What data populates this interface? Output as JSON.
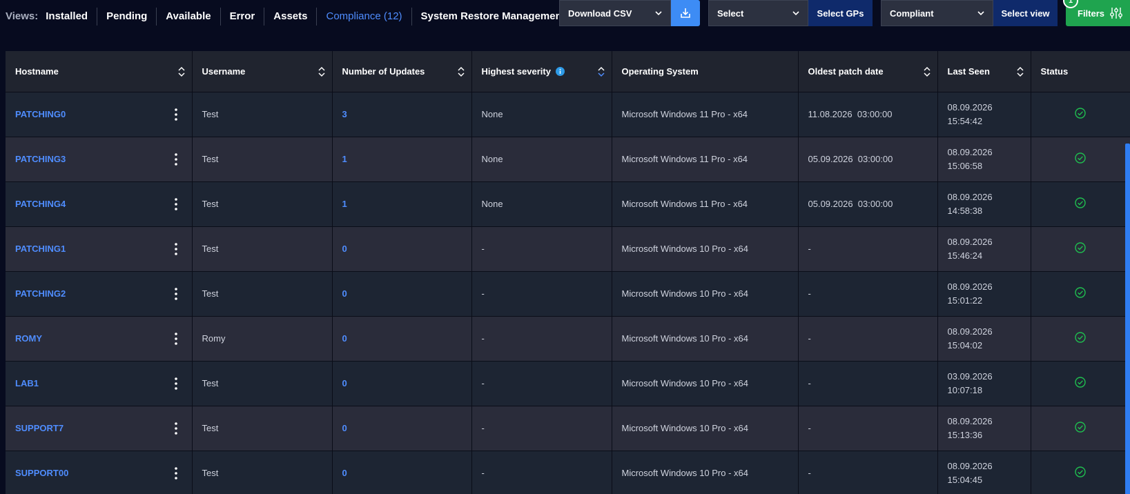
{
  "views": {
    "label": "Views:",
    "items": [
      "Installed",
      "Pending",
      "Available",
      "Error",
      "Assets",
      "Compliance (12)",
      "System Restore Management"
    ],
    "active_index": 5
  },
  "toolbar": {
    "download_csv_label": "Download CSV",
    "gp_select_label": "Select",
    "select_gps_label": "Select GPs",
    "view_select_label": "Compliant",
    "select_view_label": "Select view",
    "filters_label": "Filters",
    "filters_badge": "1"
  },
  "table": {
    "headers": {
      "hostname": "Hostname",
      "username": "Username",
      "updates": "Number of Updates",
      "severity": "Highest severity",
      "os": "Operating System",
      "oldest": "Oldest patch date",
      "last_seen": "Last Seen",
      "status": "Status"
    },
    "rows": [
      {
        "hostname": "PATCHING0",
        "username": "Test",
        "updates": "3",
        "severity": "None",
        "os": "Microsoft Windows 11 Pro - x64",
        "oldest": "11.08.2026  03:00:00",
        "last_seen_date": "08.09.2026",
        "last_seen_time": "15:54:42"
      },
      {
        "hostname": "PATCHING3",
        "username": "Test",
        "updates": "1",
        "severity": "None",
        "os": "Microsoft Windows 11 Pro - x64",
        "oldest": "05.09.2026  03:00:00",
        "last_seen_date": "08.09.2026",
        "last_seen_time": "15:06:58"
      },
      {
        "hostname": "PATCHING4",
        "username": "Test",
        "updates": "1",
        "severity": "None",
        "os": "Microsoft Windows 11 Pro - x64",
        "oldest": "05.09.2026  03:00:00",
        "last_seen_date": "08.09.2026",
        "last_seen_time": "14:58:38"
      },
      {
        "hostname": "PATCHING1",
        "username": "Test",
        "updates": "0",
        "severity": "-",
        "os": "Microsoft Windows 10 Pro - x64",
        "oldest": "-",
        "last_seen_date": "08.09.2026",
        "last_seen_time": "15:46:24"
      },
      {
        "hostname": "PATCHING2",
        "username": "Test",
        "updates": "0",
        "severity": "-",
        "os": "Microsoft Windows 10 Pro - x64",
        "oldest": "-",
        "last_seen_date": "08.09.2026",
        "last_seen_time": "15:01:22"
      },
      {
        "hostname": "ROMY",
        "username": "Romy",
        "updates": "0",
        "severity": "-",
        "os": "Microsoft Windows 10 Pro - x64",
        "oldest": "-",
        "last_seen_date": "08.09.2026",
        "last_seen_time": "15:04:02"
      },
      {
        "hostname": "LAB1",
        "username": "Test",
        "updates": "0",
        "severity": "-",
        "os": "Microsoft Windows 10 Pro - x64",
        "oldest": "-",
        "last_seen_date": "03.09.2026",
        "last_seen_time": "10:07:18"
      },
      {
        "hostname": "SUPPORT7",
        "username": "Test",
        "updates": "0",
        "severity": "-",
        "os": "Microsoft Windows 10 Pro - x64",
        "oldest": "-",
        "last_seen_date": "08.09.2026",
        "last_seen_time": "15:13:36"
      },
      {
        "hostname": "SUPPORT00",
        "username": "Test",
        "updates": "0",
        "severity": "-",
        "os": "Microsoft Windows 10 Pro - x64",
        "oldest": "-",
        "last_seen_date": "08.09.2026",
        "last_seen_time": "15:04:45"
      }
    ]
  },
  "colors": {
    "accent": "#4f8dff",
    "status_ok": "#1fbf4f",
    "filters_green": "#1fa44f",
    "download_blue": "#3d8cf5",
    "dark_blue_button": "#0f2a6b"
  },
  "icons": {
    "download": "download-icon",
    "chevron": "chevron-down-icon",
    "sort": "sort-icon",
    "kebab": "kebab-menu-icon",
    "status": "check-circle-icon",
    "info": "info-icon",
    "filters": "sliders-icon"
  }
}
